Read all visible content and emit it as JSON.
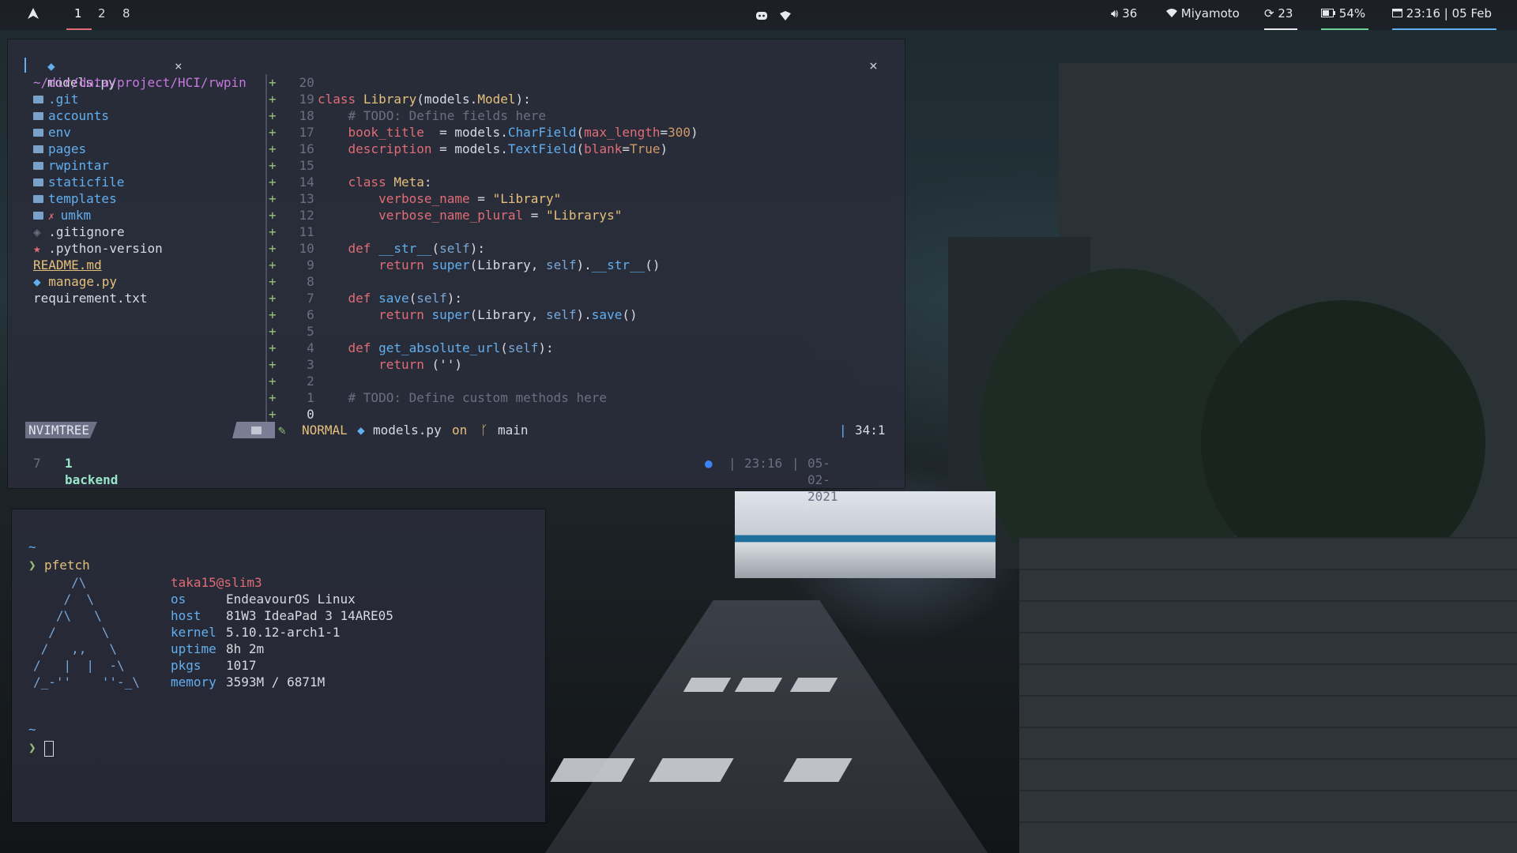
{
  "topbar": {
    "workspaces": [
      "1",
      "2",
      "8"
    ],
    "active_workspace": "1",
    "volume": "36",
    "wifi": "Miyamoto",
    "updates": "23",
    "battery": "54%",
    "datetime": "23:16 | 05 Feb",
    "colors": {
      "accent": "#e06c75",
      "battery_underline": "#6fcf97",
      "date_underline": "#61afef"
    },
    "icons": [
      "arch-logo-icon",
      "discord-icon",
      "dropbox-icon",
      "volume-icon",
      "wifi-icon",
      "updates-icon",
      "battery-icon",
      "calendar-icon"
    ]
  },
  "editor": {
    "tab_title": "models.py",
    "tree": {
      "root": "~/dir/data/project/HCI/rwpin",
      "items": [
        {
          "name": ".git",
          "type": "folder"
        },
        {
          "name": "accounts",
          "type": "folder"
        },
        {
          "name": "env",
          "type": "folder"
        },
        {
          "name": "pages",
          "type": "folder"
        },
        {
          "name": "rwpintar",
          "type": "folder"
        },
        {
          "name": "staticfile",
          "type": "folder"
        },
        {
          "name": "templates",
          "type": "folder"
        },
        {
          "name": "umkm",
          "type": "folder-error"
        },
        {
          "name": ".gitignore",
          "type": "git"
        },
        {
          "name": ".python-version",
          "type": "star"
        },
        {
          "name": "README.md",
          "type": "readme"
        },
        {
          "name": "manage.py",
          "type": "python"
        },
        {
          "name": "requirement.txt",
          "type": "file"
        }
      ]
    },
    "gutter_sign": "+",
    "line_numbers": [
      "20",
      "19",
      "18",
      "17",
      "16",
      "15",
      "14",
      "13",
      "12",
      "11",
      "10",
      "9",
      "8",
      "7",
      "6",
      "5",
      "4",
      "3",
      "2",
      "1",
      "0"
    ],
    "code": {
      "l1": {
        "kw": "class",
        "name": "Library",
        "p1": "(models.",
        "base": "Model",
        "p2": "):"
      },
      "l2": "# TODO: Define fields here",
      "l3": {
        "field": "book_title",
        "eq": "  = models.",
        "fn": "CharField",
        "open": "(",
        "arg": "max_length",
        "argeq": "=",
        "num": "300",
        "close": ")"
      },
      "l4": {
        "field": "description",
        "eq": " = models.",
        "fn": "TextField",
        "open": "(",
        "arg": "blank",
        "argeq": "=",
        "val": "True",
        "close": ")"
      },
      "l6": {
        "kw": "class",
        "name": "Meta",
        "colon": ":"
      },
      "l7": {
        "field": "verbose_name",
        "eq": " = ",
        "str": "\"Library\""
      },
      "l8": {
        "field": "verbose_name_plural",
        "eq": " = ",
        "str": "\"Librarys\""
      },
      "l10": {
        "kw": "def",
        "fn": "__str__",
        "open": "(",
        "self": "self",
        "close": "):"
      },
      "l11": {
        "kw": "return",
        "fn": "super",
        "open": "(Library, ",
        "self": "self",
        "mid": ").",
        "call": "__str__",
        "close": "()"
      },
      "l13": {
        "kw": "def",
        "fn": "save",
        "open": "(",
        "self": "self",
        "close": "):"
      },
      "l14": {
        "kw": "return",
        "fn": "super",
        "open": "(Library, ",
        "self": "self",
        "mid": ").",
        "call": "save",
        "close": "()"
      },
      "l16": {
        "kw": "def",
        "fn": "get_absolute_url",
        "open": "(",
        "self": "self",
        "close": "):"
      },
      "l17": {
        "kw": "return",
        "rest": " ('')"
      },
      "l19": "# TODO: Define custom methods here"
    },
    "statusline": {
      "nvimtree": "NVIMTREE",
      "mode": "NORMAL",
      "file": "models.py",
      "on": "on",
      "branch": "main",
      "position": "34:1"
    },
    "cmdline": {
      "num": "7",
      "text": "1 backend",
      "time": "23:16",
      "date": "05-02-2021"
    }
  },
  "terminal": {
    "prompt_tilde": "~",
    "prompt_symbol": "❯",
    "command": "pfetch",
    "ascii_art": "     /\\\n    /  \\\n   /\\   \\\n  /      \\\n /   ,,   \\\n/   |  |  -\\\n/_-''    ''-_\\",
    "user_host": "taka15@slim3",
    "info": [
      {
        "key": "os",
        "value": "EndeavourOS Linux"
      },
      {
        "key": "host",
        "value": "81W3 IdeaPad 3 14ARE05"
      },
      {
        "key": "kernel",
        "value": "5.10.12-arch1-1"
      },
      {
        "key": "uptime",
        "value": "8h 2m"
      },
      {
        "key": "pkgs",
        "value": "1017"
      },
      {
        "key": "memory",
        "value": "3593M / 6871M"
      }
    ]
  }
}
